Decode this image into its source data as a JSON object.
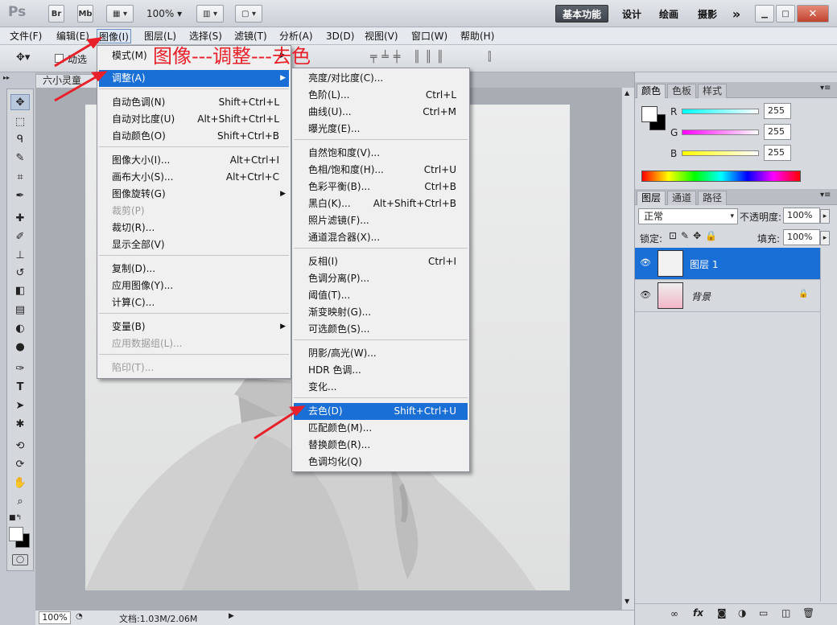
{
  "titlebar": {
    "logo": "Ps",
    "br": "Br",
    "mb": "Mb",
    "zoom": "100%",
    "workspaces": [
      "基本功能",
      "设计",
      "绘画",
      "摄影"
    ],
    "more": "»"
  },
  "menubar": [
    "文件(F)",
    "编辑(E)",
    "图像(I)",
    "图层(L)",
    "选择(S)",
    "滤镜(T)",
    "分析(A)",
    "3D(D)",
    "视图(V)",
    "窗口(W)",
    "帮助(H)"
  ],
  "optbar": {
    "partial_label": "动选"
  },
  "annotation": "图像---调整---去色",
  "document": {
    "tab_label": "六小灵童",
    "zoom": "100%",
    "doc_info": "文档:1.03M/2.06M"
  },
  "image_menu": {
    "items": [
      {
        "label": "模式(M)",
        "shortcut": "",
        "arrow": true,
        "disabled": false,
        "selected": false
      },
      {
        "label": "调整(A)",
        "shortcut": "",
        "arrow": true,
        "disabled": false,
        "selected": true
      },
      {
        "label": "自动色调(N)",
        "shortcut": "Shift+Ctrl+L",
        "arrow": false,
        "disabled": false,
        "selected": false
      },
      {
        "label": "自动对比度(U)",
        "shortcut": "Alt+Shift+Ctrl+L",
        "arrow": false,
        "disabled": false,
        "selected": false
      },
      {
        "label": "自动颜色(O)",
        "shortcut": "Shift+Ctrl+B",
        "arrow": false,
        "disabled": false,
        "selected": false
      },
      {
        "label": "图像大小(I)...",
        "shortcut": "Alt+Ctrl+I",
        "arrow": false,
        "disabled": false,
        "selected": false
      },
      {
        "label": "画布大小(S)...",
        "shortcut": "Alt+Ctrl+C",
        "arrow": false,
        "disabled": false,
        "selected": false
      },
      {
        "label": "图像旋转(G)",
        "shortcut": "",
        "arrow": true,
        "disabled": false,
        "selected": false
      },
      {
        "label": "裁剪(P)",
        "shortcut": "",
        "arrow": false,
        "disabled": true,
        "selected": false
      },
      {
        "label": "裁切(R)...",
        "shortcut": "",
        "arrow": false,
        "disabled": false,
        "selected": false
      },
      {
        "label": "显示全部(V)",
        "shortcut": "",
        "arrow": false,
        "disabled": false,
        "selected": false
      },
      {
        "label": "复制(D)...",
        "shortcut": "",
        "arrow": false,
        "disabled": false,
        "selected": false
      },
      {
        "label": "应用图像(Y)...",
        "shortcut": "",
        "arrow": false,
        "disabled": false,
        "selected": false
      },
      {
        "label": "计算(C)...",
        "shortcut": "",
        "arrow": false,
        "disabled": false,
        "selected": false
      },
      {
        "label": "变量(B)",
        "shortcut": "",
        "arrow": true,
        "disabled": false,
        "selected": false
      },
      {
        "label": "应用数据组(L)...",
        "shortcut": "",
        "arrow": false,
        "disabled": true,
        "selected": false
      },
      {
        "label": "陷印(T)...",
        "shortcut": "",
        "arrow": false,
        "disabled": true,
        "selected": false
      }
    ]
  },
  "adjust_menu": {
    "items": [
      {
        "label": "亮度/对比度(C)...",
        "shortcut": ""
      },
      {
        "label": "色阶(L)...",
        "shortcut": "Ctrl+L"
      },
      {
        "label": "曲线(U)...",
        "shortcut": "Ctrl+M"
      },
      {
        "label": "曝光度(E)...",
        "shortcut": ""
      },
      {
        "label": "自然饱和度(V)...",
        "shortcut": ""
      },
      {
        "label": "色相/饱和度(H)...",
        "shortcut": "Ctrl+U"
      },
      {
        "label": "色彩平衡(B)...",
        "shortcut": "Ctrl+B"
      },
      {
        "label": "黑白(K)...",
        "shortcut": "Alt+Shift+Ctrl+B"
      },
      {
        "label": "照片滤镜(F)...",
        "shortcut": ""
      },
      {
        "label": "通道混合器(X)...",
        "shortcut": ""
      },
      {
        "label": "反相(I)",
        "shortcut": "Ctrl+I"
      },
      {
        "label": "色调分离(P)...",
        "shortcut": ""
      },
      {
        "label": "阈值(T)...",
        "shortcut": ""
      },
      {
        "label": "渐变映射(G)...",
        "shortcut": ""
      },
      {
        "label": "可选颜色(S)...",
        "shortcut": ""
      },
      {
        "label": "阴影/高光(W)...",
        "shortcut": ""
      },
      {
        "label": "HDR 色调...",
        "shortcut": ""
      },
      {
        "label": "变化...",
        "shortcut": ""
      },
      {
        "label": "去色(D)",
        "shortcut": "Shift+Ctrl+U"
      },
      {
        "label": "匹配颜色(M)...",
        "shortcut": ""
      },
      {
        "label": "替换颜色(R)...",
        "shortcut": ""
      },
      {
        "label": "色调均化(Q)",
        "shortcut": ""
      }
    ]
  },
  "color_panel": {
    "tabs": [
      "颜色",
      "色板",
      "样式"
    ],
    "channels": [
      {
        "label": "R",
        "value": "255"
      },
      {
        "label": "G",
        "value": "255"
      },
      {
        "label": "B",
        "value": "255"
      }
    ]
  },
  "layers_panel": {
    "tabs": [
      "图层",
      "通道",
      "路径"
    ],
    "blend_mode": "正常",
    "opacity_label": "不透明度:",
    "opacity": "100%",
    "lock_label": "锁定:",
    "fill_label": "填充:",
    "fill": "100%",
    "layers": [
      {
        "name": "图层 1",
        "selected": true,
        "locked": false
      },
      {
        "name": "背景",
        "selected": false,
        "locked": true
      }
    ]
  },
  "colors": {
    "accent": "#1a6fd6",
    "annotation": "#e8202a"
  }
}
